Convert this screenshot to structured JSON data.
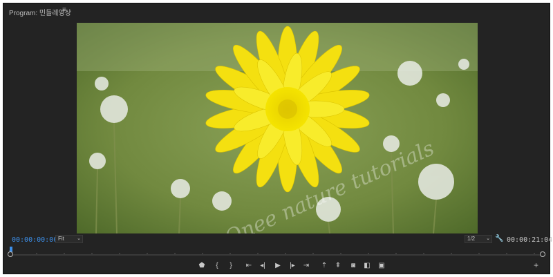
{
  "panel": {
    "title": "Program: 민들레영상",
    "menu_icon": "hamburger-icon"
  },
  "transport": {
    "current_time": "00:00:00:00",
    "fit_label": "Fit",
    "resolution_label": "1/2",
    "duration": "00:00:21:04"
  },
  "controls": [
    {
      "name": "add-marker-button",
      "icon": "marker-icon"
    },
    {
      "name": "mark-in-button",
      "icon": "mark-in-icon"
    },
    {
      "name": "mark-out-button",
      "icon": "mark-out-icon"
    },
    {
      "name": "go-to-in-button",
      "icon": "go-to-in-icon"
    },
    {
      "name": "step-back-button",
      "icon": "step-back-icon"
    },
    {
      "name": "play-button",
      "icon": "play-icon"
    },
    {
      "name": "step-forward-button",
      "icon": "step-forward-icon"
    },
    {
      "name": "go-to-out-button",
      "icon": "go-to-out-icon"
    },
    {
      "name": "lift-button",
      "icon": "lift-icon"
    },
    {
      "name": "extract-button",
      "icon": "extract-icon"
    },
    {
      "name": "export-frame-button",
      "icon": "camera-icon"
    },
    {
      "name": "comparison-view-button",
      "icon": "comparison-icon"
    },
    {
      "name": "safe-margins-button",
      "icon": "safe-margins-icon"
    }
  ],
  "watermark": "Onee nature tutorials",
  "colors": {
    "accent": "#3d8fe8",
    "panel_bg": "#232323",
    "text": "#c8c8c8"
  }
}
